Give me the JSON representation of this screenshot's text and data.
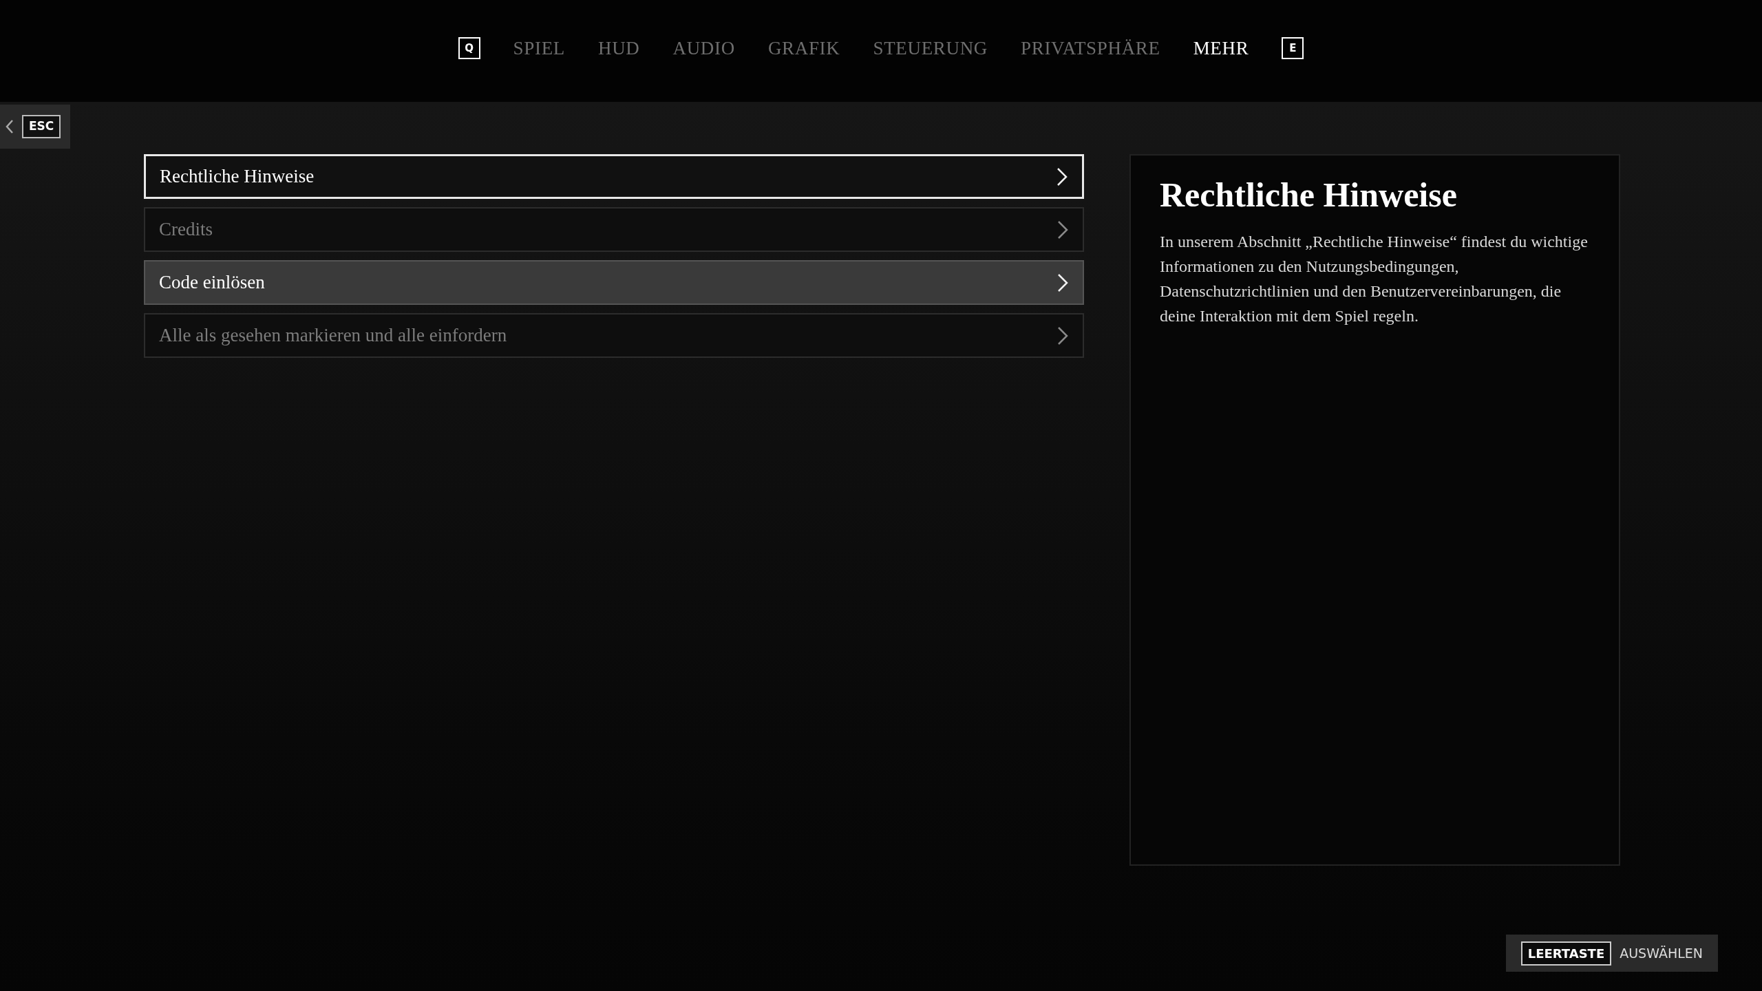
{
  "nav": {
    "prev_key": "Q",
    "next_key": "E",
    "tabs": [
      {
        "label": "SPIEL",
        "selected": false
      },
      {
        "label": "HUD",
        "selected": false
      },
      {
        "label": "AUDIO",
        "selected": false
      },
      {
        "label": "GRAFIK",
        "selected": false
      },
      {
        "label": "STEUERUNG",
        "selected": false
      },
      {
        "label": "PRIVATSPHÄRE",
        "selected": false
      },
      {
        "label": "MEHR",
        "selected": true
      }
    ]
  },
  "back": {
    "key": "ESC"
  },
  "menu": [
    {
      "label": "Rechtliche Hinweise",
      "selected": true,
      "disabled": false,
      "hovered": false
    },
    {
      "label": "Credits",
      "selected": false,
      "disabled": true,
      "hovered": false
    },
    {
      "label": "Code einlösen",
      "selected": false,
      "disabled": false,
      "hovered": true
    },
    {
      "label": "Alle als gesehen markieren und alle einfordern",
      "selected": false,
      "disabled": true,
      "hovered": false
    }
  ],
  "detail": {
    "title": "Rechtliche Hinweise",
    "body": "In unserem Abschnitt „Rechtliche Hinweise“ findest du wichtige Informationen zu den Nutzungsbedingungen, Datenschutzrichtlinien und den Benutzervereinbarungen, die deine Interaktion mit dem Spiel regeln."
  },
  "hint": {
    "key": "LEERTASTE",
    "action": "AUSWÄHLEN"
  }
}
